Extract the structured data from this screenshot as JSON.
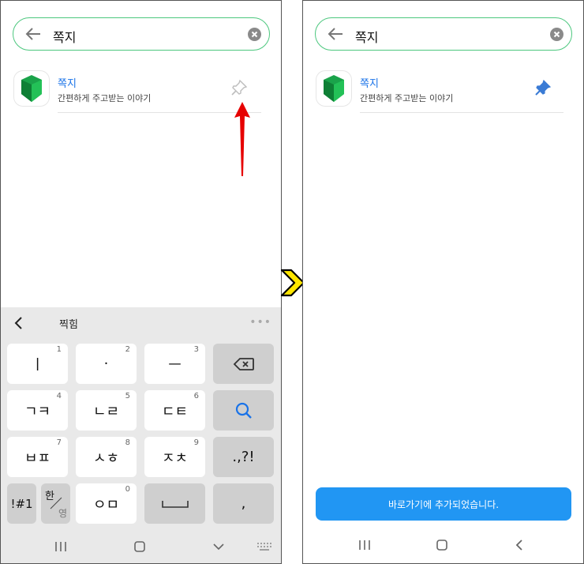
{
  "left": {
    "search": {
      "query": "쪽지"
    },
    "result": {
      "title": "쪽지",
      "subtitle": "간편하게 주고받는 이야기"
    },
    "keyboard": {
      "suggestion": "찍힘",
      "keys": [
        {
          "label": "ㅣ",
          "num": "1"
        },
        {
          "label": "·",
          "num": "2"
        },
        {
          "label": "ㅡ",
          "num": "3"
        },
        {
          "label": "ㄱㅋ",
          "num": "4"
        },
        {
          "label": "ㄴㄹ",
          "num": "5"
        },
        {
          "label": "ㄷㅌ",
          "num": "6"
        },
        {
          "label": "ㅂㅍ",
          "num": "7"
        },
        {
          "label": "ㅅㅎ",
          "num": "8"
        },
        {
          "label": "ㅈㅊ",
          "num": "9"
        },
        {
          "label": "ㅇㅁ",
          "num": "0"
        },
        {
          "label": ".,?!"
        },
        {
          "label": "!#1"
        },
        {
          "label": "한",
          "label2": "영"
        },
        {
          "label": ","
        }
      ]
    }
  },
  "right": {
    "search": {
      "query": "쪽지"
    },
    "result": {
      "title": "쪽지",
      "subtitle": "간편하게 주고받는 이야기"
    },
    "toast": "바로가기에 추가되었습니다."
  },
  "colors": {
    "accent_green": "#4cc77e",
    "pin_blue": "#3a7bd5",
    "toast_blue": "#2196f3",
    "arrow_red": "#e60000",
    "chevron_yellow": "#ffe600"
  },
  "icons": [
    "back-arrow-icon",
    "clear-icon",
    "app-icon",
    "pin-outline-icon",
    "pin-filled-icon",
    "backspace-icon",
    "search-icon",
    "chevron-left-icon"
  ]
}
